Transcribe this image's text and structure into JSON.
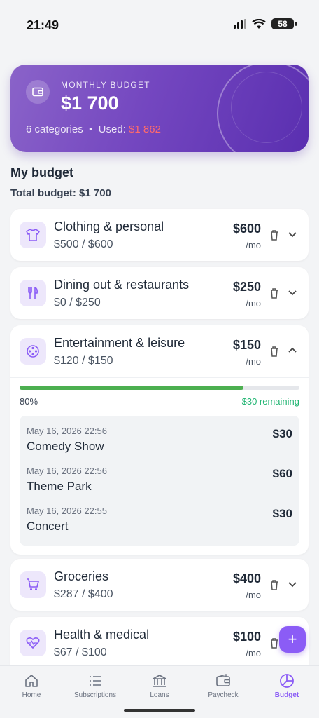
{
  "status_bar": {
    "time": "21:49",
    "battery": "58"
  },
  "budget_card": {
    "label": "MONTHLY BUDGET",
    "amount": "$1 700",
    "categories_text": "6 categories",
    "separator": "•",
    "used_label": "Used:",
    "used_value": "$1 862",
    "used_color": "#ff6b6b"
  },
  "section": {
    "title": "My budget",
    "total": "Total budget: $1 700"
  },
  "categories": [
    {
      "name": "Clothing & personal",
      "usage": "$500 / $600",
      "amount": "$600",
      "per": "/mo",
      "icon": "shirt-icon"
    },
    {
      "name": "Dining out & restaurants",
      "usage": "$0 / $250",
      "amount": "$250",
      "per": "/mo",
      "icon": "utensils-icon"
    },
    {
      "name": "Entertainment & leisure",
      "usage": "$120 / $150",
      "amount": "$150",
      "per": "/mo",
      "icon": "film-reel-icon",
      "expanded": true,
      "progress_percent": 80,
      "progress_label": "80%",
      "remaining": "$30 remaining",
      "transactions": [
        {
          "date": "May 16, 2026 22:56",
          "name": "Comedy Show",
          "amount": "$30"
        },
        {
          "date": "May 16, 2026 22:56",
          "name": "Theme Park",
          "amount": "$60"
        },
        {
          "date": "May 16, 2026 22:55",
          "name": "Concert",
          "amount": "$30"
        }
      ]
    },
    {
      "name": "Groceries",
      "usage": "$287 / $400",
      "amount": "$400",
      "per": "/mo",
      "icon": "cart-icon"
    },
    {
      "name": "Health & medical",
      "usage": "$67 / $100",
      "amount": "$100",
      "per": "/mo",
      "icon": "heart-pulse-icon"
    }
  ],
  "fab": {
    "label": "+"
  },
  "nav": [
    {
      "label": "Home",
      "icon": "home-icon"
    },
    {
      "label": "Subscriptions",
      "icon": "list-icon"
    },
    {
      "label": "Loans",
      "icon": "bank-icon"
    },
    {
      "label": "Paycheck",
      "icon": "wallet-icon"
    },
    {
      "label": "Budget",
      "icon": "pie-chart-icon",
      "active": true
    }
  ],
  "colors": {
    "accent": "#8b5cf6",
    "progress": "#4caf50",
    "remaining": "#22b573"
  }
}
